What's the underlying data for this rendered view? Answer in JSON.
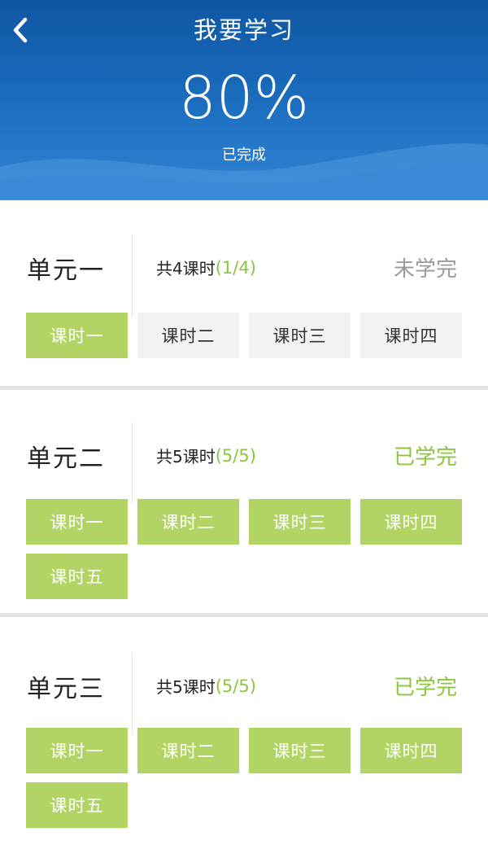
{
  "header": {
    "title": "我要学习",
    "percent": "80%",
    "caption": "已完成"
  },
  "icons": {
    "back": "chevron-left-icon"
  },
  "colors": {
    "headerBlue": "#1d6fc0",
    "green": "#8cc63f",
    "buttonGreen": "#b1d465",
    "buttonGray": "#f2f2f2"
  },
  "units": [
    {
      "name": "单元一",
      "count_label": "共4课时",
      "progress": "(1/4)",
      "status": "未学完",
      "lessons": [
        "课时一",
        "课时二",
        "课时三",
        "课时四"
      ]
    },
    {
      "name": "单元二",
      "count_label": "共5课时",
      "progress": "(5/5)",
      "status": "已学完",
      "lessons": [
        "课时一",
        "课时二",
        "课时三",
        "课时四",
        "课时五"
      ]
    },
    {
      "name": "单元三",
      "count_label": "共5课时",
      "progress": "(5/5)",
      "status": "已学完",
      "lessons": [
        "课时一",
        "课时二",
        "课时三",
        "课时四",
        "课时五"
      ]
    }
  ]
}
